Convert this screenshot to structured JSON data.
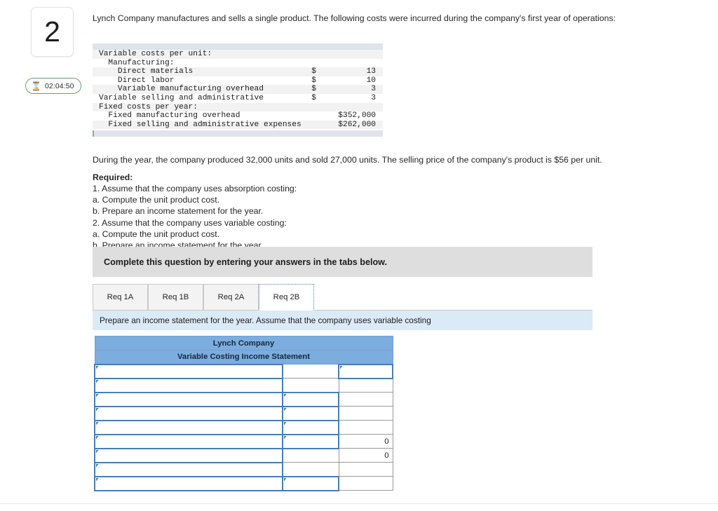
{
  "question": {
    "number": "2",
    "timer": "02:04:50",
    "timer_icon": "hourglass-icon"
  },
  "intro": "Lynch Company manufactures and sells a single product. The following costs were incurred during the company's first year of operations:",
  "cost_table": {
    "rows": [
      {
        "label": "Variable costs per unit:",
        "indent": 0,
        "symbol": "",
        "amount": "",
        "shaded": true
      },
      {
        "label": "Manufacturing:",
        "indent": 1,
        "symbol": "",
        "amount": "",
        "shaded": false
      },
      {
        "label": "Direct materials",
        "indent": 2,
        "symbol": "$",
        "amount": "13",
        "shaded": true
      },
      {
        "label": "Direct labor",
        "indent": 2,
        "symbol": "$",
        "amount": "10",
        "shaded": false
      },
      {
        "label": "Variable manufacturing overhead",
        "indent": 2,
        "symbol": "$",
        "amount": "3",
        "shaded": true
      },
      {
        "label": "Variable selling and administrative",
        "indent": 0,
        "symbol": "$",
        "amount": "3",
        "shaded": false
      },
      {
        "label": "Fixed costs per year:",
        "indent": 0,
        "symbol": "",
        "amount": "",
        "shaded": true
      },
      {
        "label": "Fixed manufacturing overhead",
        "indent": 1,
        "symbol": "",
        "amount": "$352,000",
        "shaded": false
      },
      {
        "label": "Fixed selling and administrative expenses",
        "indent": 1,
        "symbol": "",
        "amount": "$262,000",
        "shaded": true
      }
    ]
  },
  "during_text": "During the year, the company produced 32,000 units and sold 27,000 units. The selling price of the company's product is $56 per unit.",
  "required": {
    "heading": "Required:",
    "lines": [
      "1. Assume that the company uses absorption costing:",
      "a. Compute the unit product cost.",
      "b. Prepare an income statement for the year.",
      "2. Assume that the company uses variable costing:",
      "a. Compute the unit product cost.",
      "b. Prepare an income statement for the year."
    ]
  },
  "banner_text": "Complete this question by entering your answers in the tabs below.",
  "tabs": [
    {
      "label": "Req 1A",
      "active": false
    },
    {
      "label": "Req 1B",
      "active": false
    },
    {
      "label": "Req 2A",
      "active": false
    },
    {
      "label": "Req 2B",
      "active": true
    }
  ],
  "tab_instruction": "Prepare an income statement for the year. Assume that the company uses variable costing",
  "answer_table": {
    "title_line_1": "Lynch Company",
    "title_line_2": "Variable Costing Income Statement",
    "rows": [
      {
        "c1": {
          "type": "input",
          "value": ""
        },
        "c2": {
          "type": "plain",
          "value": ""
        },
        "c3": {
          "type": "input",
          "value": ""
        }
      },
      {
        "c1": {
          "type": "input",
          "value": ""
        },
        "c2": {
          "type": "plain",
          "value": ""
        },
        "c3": {
          "type": "plain",
          "value": ""
        }
      },
      {
        "c1": {
          "type": "input",
          "value": ""
        },
        "c2": {
          "type": "input",
          "value": ""
        },
        "c3": {
          "type": "plain",
          "value": ""
        }
      },
      {
        "c1": {
          "type": "input",
          "value": ""
        },
        "c2": {
          "type": "input",
          "value": ""
        },
        "c3": {
          "type": "plain",
          "value": ""
        }
      },
      {
        "c1": {
          "type": "input",
          "value": ""
        },
        "c2": {
          "type": "input",
          "value": ""
        },
        "c3": {
          "type": "plain",
          "value": ""
        }
      },
      {
        "c1": {
          "type": "input",
          "value": ""
        },
        "c2": {
          "type": "input",
          "value": ""
        },
        "c3": {
          "type": "plain",
          "value": "0"
        }
      },
      {
        "c1": {
          "type": "input",
          "value": ""
        },
        "c2": {
          "type": "plain",
          "value": ""
        },
        "c3": {
          "type": "plain",
          "value": "0"
        }
      },
      {
        "c1": {
          "type": "input",
          "value": ""
        },
        "c2": {
          "type": "plain",
          "value": ""
        },
        "c3": {
          "type": "plain",
          "value": ""
        }
      },
      {
        "c1": {
          "type": "input",
          "value": ""
        },
        "c2": {
          "type": "input",
          "value": ""
        },
        "c3": {
          "type": "plain",
          "value": ""
        }
      }
    ]
  },
  "colors": {
    "header_blue": "#7cadde",
    "input_border": "#4a7db5",
    "banner_gray": "#dedede",
    "instruction_blue": "#dbeaf7",
    "timer_green": "#67a06a"
  }
}
